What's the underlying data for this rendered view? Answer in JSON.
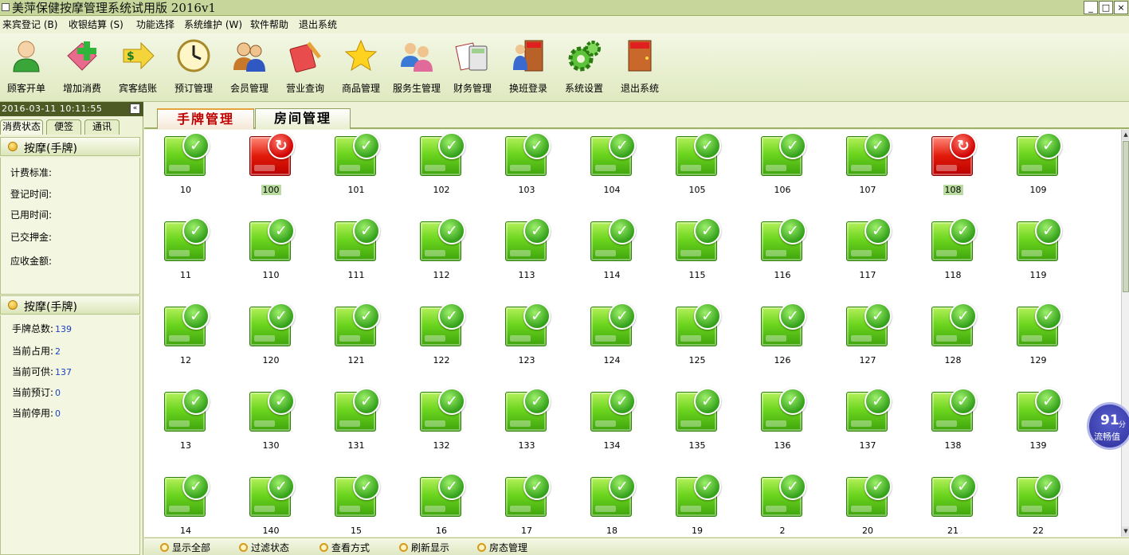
{
  "window": {
    "title": "美萍保健按摩管理系统试用版 2016v1",
    "controls": [
      "_",
      "□",
      "×"
    ]
  },
  "menu": [
    "来宾登记 (B)",
    "收银结算 (S)",
    "功能选择",
    "系统维护 (W)",
    "软件帮助",
    "退出系统"
  ],
  "toolbar": [
    {
      "label": "顾客开单",
      "icon": "customer-icon"
    },
    {
      "label": "增加消费",
      "icon": "add-consumption-icon"
    },
    {
      "label": "宾客结账",
      "icon": "checkout-icon"
    },
    {
      "label": "预订管理",
      "icon": "clock-icon"
    },
    {
      "label": "会员管理",
      "icon": "members-icon"
    },
    {
      "label": "营业查询",
      "icon": "notebook-icon"
    },
    {
      "label": "商品管理",
      "icon": "star-icon"
    },
    {
      "label": "服务生管理",
      "icon": "staff-icon"
    },
    {
      "label": "财务管理",
      "icon": "calculator-icon"
    },
    {
      "label": "换班登录",
      "icon": "exit-person-icon"
    },
    {
      "label": "系统设置",
      "icon": "gear-icon"
    },
    {
      "label": "退出系统",
      "icon": "exit-door-icon"
    }
  ],
  "left_panel": {
    "datetime": "2016-03-11 10:11:55",
    "collapse_label": "«",
    "tabs": [
      "消费状态",
      "便签",
      "通讯"
    ],
    "section1": {
      "title": "按摩(手牌)",
      "fields": [
        "计费标准:",
        "登记时间:",
        "已用时间:",
        "已交押金:",
        "应收金额:"
      ]
    },
    "section2": {
      "title": "按摩(手牌)",
      "stats": [
        {
          "label": "手牌总数:",
          "value": "139"
        },
        {
          "label": "当前占用:",
          "value": "2"
        },
        {
          "label": "当前可供:",
          "value": "137"
        },
        {
          "label": "当前预订:",
          "value": "0"
        },
        {
          "label": "当前停用:",
          "value": "0"
        }
      ]
    }
  },
  "main_tabs": [
    "手牌管理",
    "房间管理"
  ],
  "grid": {
    "rows": [
      [
        "10",
        "100",
        "101",
        "102",
        "103",
        "104",
        "105",
        "106",
        "107",
        "108",
        "109"
      ],
      [
        "11",
        "110",
        "111",
        "112",
        "113",
        "114",
        "115",
        "116",
        "117",
        "118",
        "119"
      ],
      [
        "12",
        "120",
        "121",
        "122",
        "123",
        "124",
        "125",
        "126",
        "127",
        "128",
        "129"
      ],
      [
        "13",
        "130",
        "131",
        "132",
        "133",
        "134",
        "135",
        "136",
        "137",
        "138",
        "139"
      ],
      [
        "14",
        "140",
        "15",
        "16",
        "17",
        "18",
        "19",
        "2",
        "20",
        "21",
        "22"
      ]
    ],
    "occupied": [
      "100",
      "108"
    ],
    "available_glyph": "✓",
    "occupied_glyph": "↻"
  },
  "bottom_bar": [
    "显示全部",
    "过滤状态",
    "查看方式",
    "刷新显示",
    "房态管理"
  ],
  "fluency_widget": {
    "score": "91",
    "unit": "分",
    "caption": "流畅值"
  },
  "colors": {
    "available": "#4fc21a",
    "occupied": "#d40000",
    "accent": "#c00000"
  }
}
